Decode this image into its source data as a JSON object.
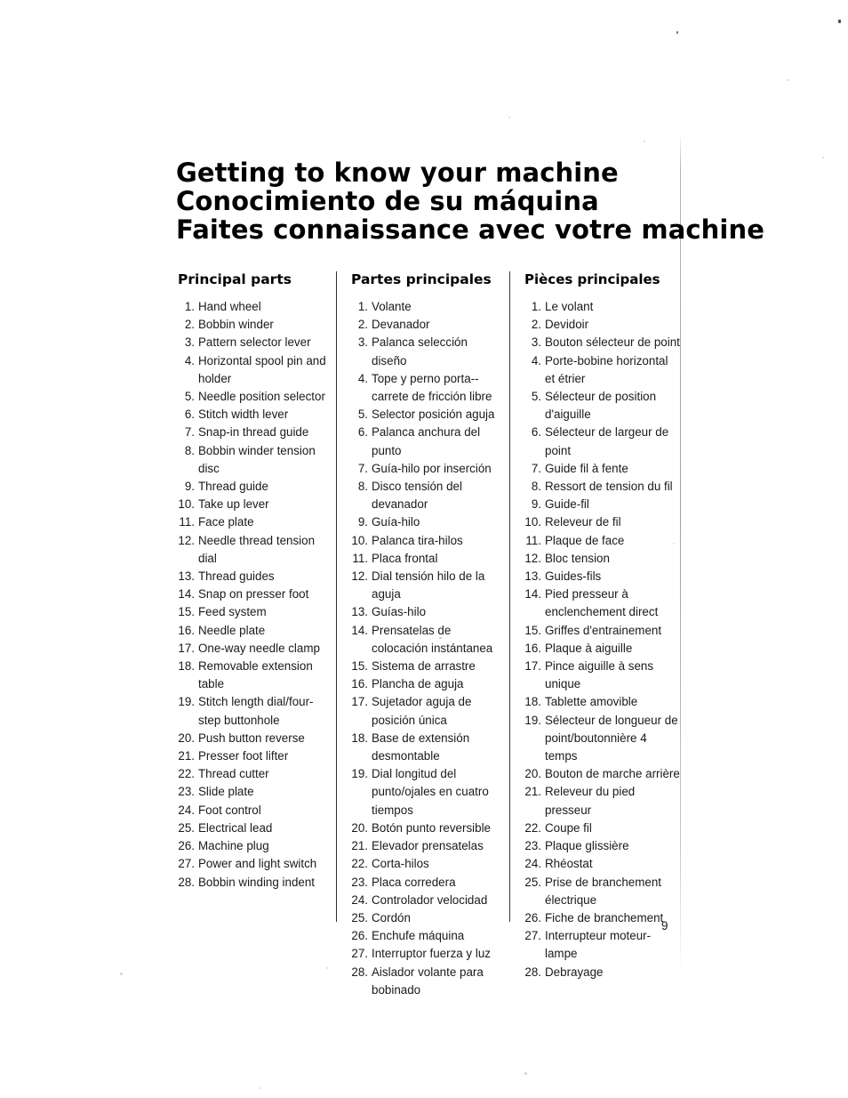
{
  "document": {
    "page_number": "9",
    "headings": [
      "Getting to know your machine",
      "Conocimiento de su máquina",
      "Faites connaissance avec votre machine"
    ]
  },
  "columns": {
    "english": {
      "heading": "Principal parts",
      "items": [
        "Hand wheel",
        "Bobbin winder",
        "Pattern selector lever",
        "Horizontal spool pin and holder",
        "Needle position selector",
        "Stitch width lever",
        "Snap-in thread guide",
        "Bobbin winder tension disc",
        "Thread guide",
        "Take up lever",
        "Face plate",
        "Needle thread tension dial",
        "Thread guides",
        "Snap on presser foot",
        "Feed system",
        "Needle plate",
        "One-way needle clamp",
        "Removable extension table",
        "Stitch length dial/four-step buttonhole",
        "Push button reverse",
        "Presser foot lifter",
        "Thread cutter",
        "Slide plate",
        "Foot control",
        "Electrical lead",
        "Machine plug",
        "Power and light switch",
        "Bobbin winding indent"
      ]
    },
    "spanish": {
      "heading": "Partes principales",
      "items": [
        "Volante",
        "Devanador",
        "Palanca selección diseño",
        "Tope y perno porta--carrete de fricción libre",
        "Selector posición aguja",
        "Palanca anchura del punto",
        "Guía-hilo por inserción",
        "Disco tensión del devanador",
        "Guía-hilo",
        "Palanca tira-hilos",
        "Placa frontal",
        "Dial tensión hilo de la aguja",
        "Guías-hilo",
        "Prensatelas de colocación instántanea",
        "Sistema de arrastre",
        "Plancha de aguja",
        "Sujetador aguja de posición única",
        "Base de extensión desmontable",
        "Dial longitud del punto/ojales en cuatro tiempos",
        "Botón punto reversible",
        "Elevador prensatelas",
        "Corta-hilos",
        "Placa corredera",
        "Controlador velocidad",
        "Cordón",
        "Enchufe máquina",
        "Interruptor fuerza y luz",
        "Aislador volante para bobinado"
      ]
    },
    "french": {
      "heading": "Pièces principales",
      "items": [
        "Le volant",
        "Devidoir",
        "Bouton sélecteur de point",
        "Porte-bobine horizontal et étrier",
        "Sélecteur de position d'aiguille",
        "Sélecteur de largeur de point",
        "Guide fil à fente",
        "Ressort de tension du fil",
        "Guide-fil",
        "Releveur de fil",
        "Plaque de face",
        "Bloc tension",
        "Guides-fils",
        "Pied presseur à enclenchement direct",
        "Griffes d'entrainement",
        "Plaque à aiguille",
        "Pince aiguille à sens unique",
        "Tablette amovible",
        "Sélecteur de longueur de point/boutonnière 4 temps",
        "Bouton de marche arrière",
        "Releveur du pied presseur",
        "Coupe fil",
        "Plaque glissière",
        "Rhéostat",
        "Prise de branchement électrique",
        "Fiche de branchement",
        "Interrupteur moteur-lampe",
        "Debrayage"
      ]
    }
  }
}
